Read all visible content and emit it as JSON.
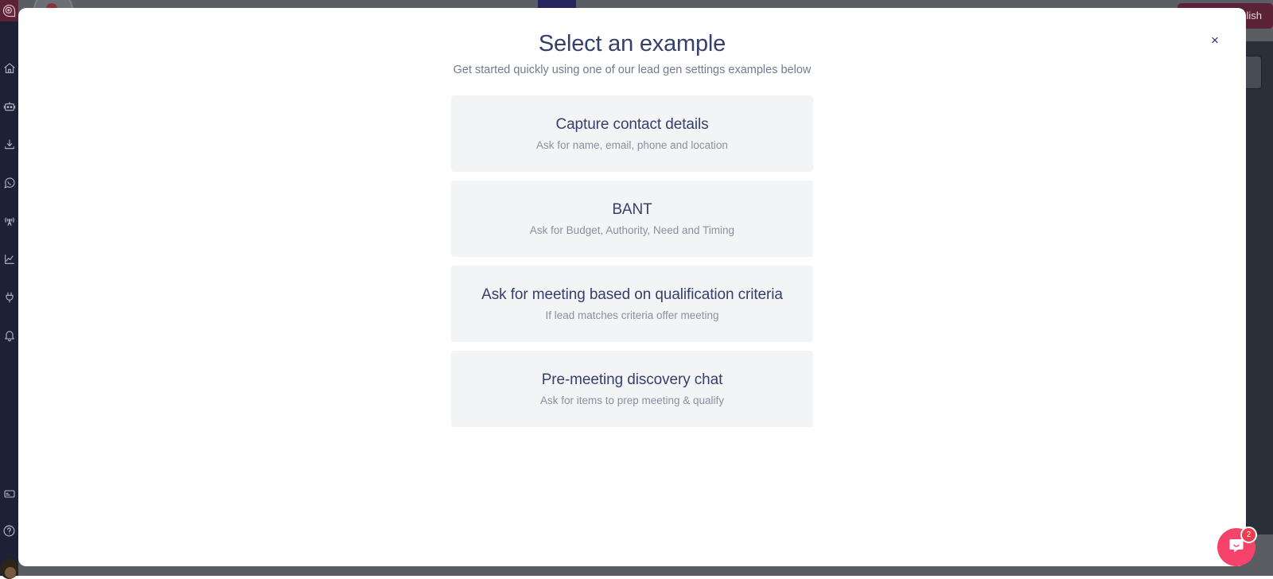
{
  "background": {
    "publish_button_label": "Publish",
    "accent_maroon": "#5b2236",
    "panel_dark": "#2b2f3a",
    "overlay_gray": "#5a5d61"
  },
  "sidebar": {
    "logo_name": "app-logo",
    "items": [
      {
        "icon": "home-icon",
        "label": "Home"
      },
      {
        "icon": "robot-icon",
        "label": "Bots"
      },
      {
        "icon": "download-inbox-icon",
        "label": "Inbox"
      },
      {
        "icon": "whatsapp-icon",
        "label": "WhatsApp"
      },
      {
        "icon": "broadcast-antenna-icon",
        "label": "Broadcast"
      },
      {
        "icon": "analytics-chart-icon",
        "label": "Analytics"
      },
      {
        "icon": "plug-integrations-icon",
        "label": "Integrations"
      },
      {
        "icon": "bell-notifications-icon",
        "label": "Notifications"
      }
    ],
    "bottom_items": [
      {
        "icon": "billing-card-icon",
        "label": "Billing"
      },
      {
        "icon": "help-question-icon",
        "label": "Help"
      }
    ],
    "avatar_name": "user-avatar"
  },
  "modal": {
    "title": "Select an example",
    "subtitle": "Get started quickly using one of our lead gen settings examples below",
    "close_label": "×",
    "examples": [
      {
        "title": "Capture contact details",
        "description": "Ask for name, email, phone and location"
      },
      {
        "title": "BANT",
        "description": "Ask for Budget, Authority, Need and Timing"
      },
      {
        "title": "Ask for meeting based on qualification criteria",
        "description": "If lead matches criteria offer meeting"
      },
      {
        "title": "Pre-meeting discovery chat",
        "description": "Ask for items to prep meeting & qualify"
      }
    ]
  },
  "intercom": {
    "icon": "chat-bubble-icon",
    "unread_count": "2",
    "color": "#f5436b"
  }
}
